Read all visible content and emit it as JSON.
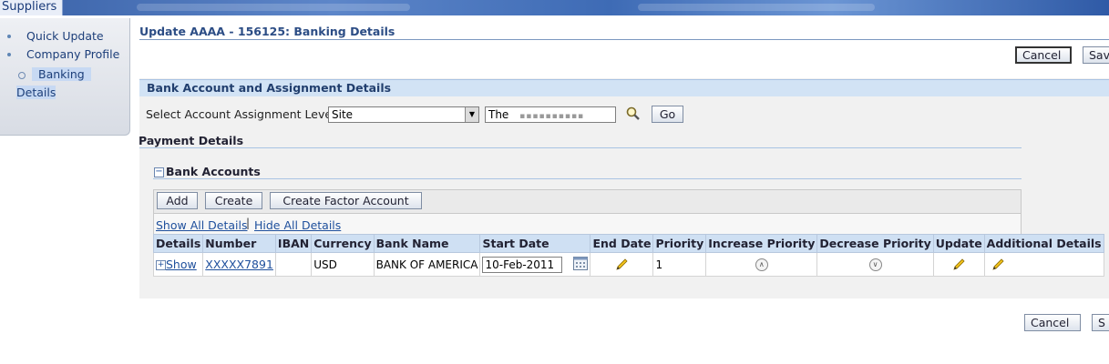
{
  "topbar": {
    "tab_label": "Suppliers"
  },
  "sidebar": {
    "items": [
      {
        "label": "Quick Update"
      },
      {
        "label": "Company Profile"
      },
      {
        "label_part1": "Banking",
        "label_part2": "Details"
      }
    ]
  },
  "page": {
    "title": "Update AAAA - 156125: Banking Details"
  },
  "actions": {
    "cancel_label": "Cancel",
    "save_label_partial": "Sav",
    "save_label_partial_bottom": "S"
  },
  "assignment": {
    "header": "Bank Account and Assignment Details",
    "level_label": "Select Account Assignment Level",
    "level_value": "Site",
    "site_value": "The",
    "go_label": "Go"
  },
  "payment": {
    "header": "Payment Details"
  },
  "bank_accounts": {
    "header": "Bank Accounts",
    "toolbar": {
      "add": "Add",
      "create": "Create",
      "create_factor": "Create Factor Account"
    },
    "show_all": "Show All Details",
    "hide_all": "Hide All Details",
    "columns": [
      "Details",
      "Number",
      "IBAN",
      "Currency",
      "Bank Name",
      "Start Date",
      "End Date",
      "Priority",
      "Increase Priority",
      "Decrease Priority",
      "Update",
      "Additional Details"
    ],
    "rows": [
      {
        "details": "Show",
        "number": "XXXXX7891",
        "iban": "",
        "currency": "USD",
        "bank_name": "BANK OF AMERICA",
        "start_date": "10-Feb-2011",
        "end_date": "",
        "priority": "1"
      }
    ]
  },
  "colors": {
    "accent": "#1e4f9c",
    "header_bg": "#d2e3f5",
    "title": "#2c4d85"
  },
  "icons": [
    "search-icon",
    "calendar-icon",
    "pencil-icon",
    "expand-icon",
    "up-arrow-icon",
    "down-arrow-icon",
    "select-arrow-icon"
  ]
}
